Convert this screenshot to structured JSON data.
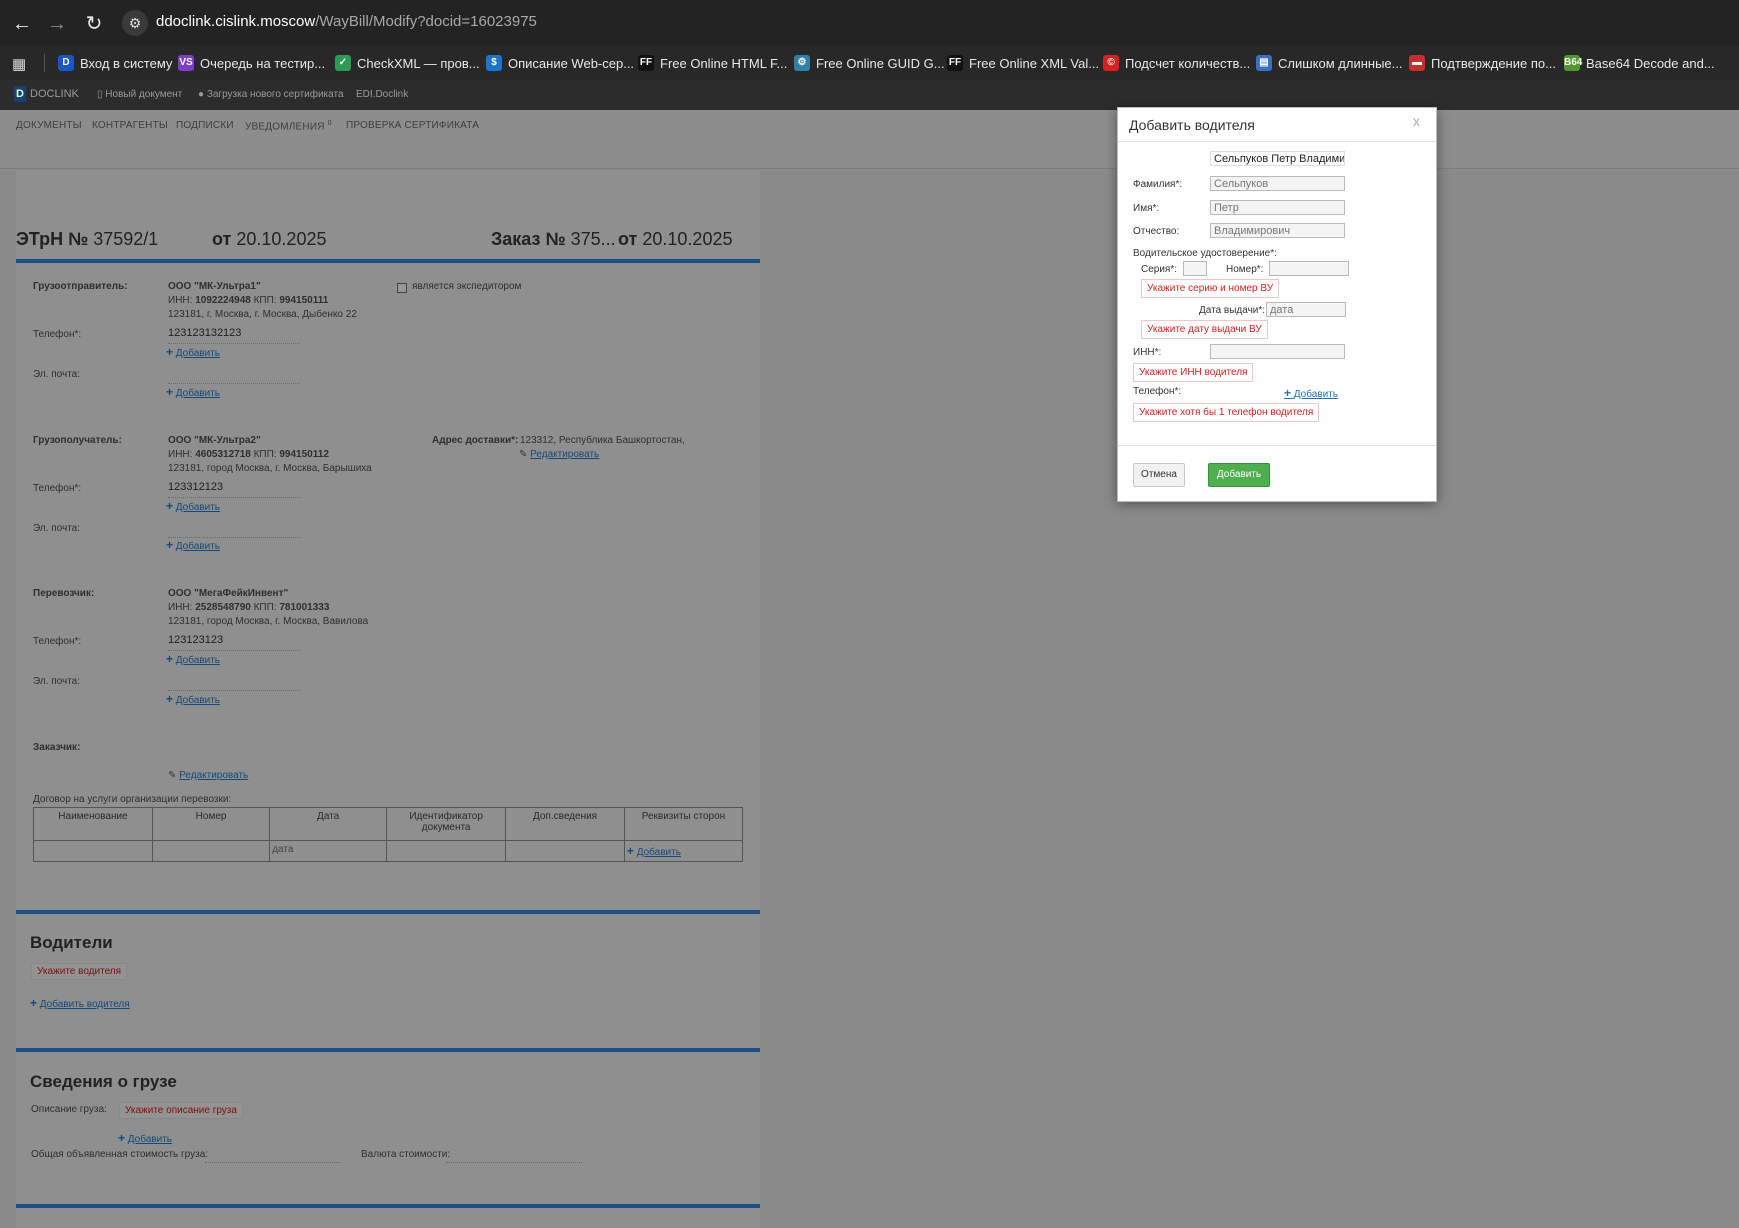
{
  "browser": {
    "url_host": "ddoclink.cislink.moscow",
    "url_path": "/WayBill/Modify?docid=16023975",
    "bookmarks": [
      {
        "label": "Вход в систему",
        "icon": "D",
        "color": "#1a56c4"
      },
      {
        "label": "Очередь на тестир...",
        "icon": "VS",
        "color": "#7b3fc9"
      },
      {
        "label": "CheckXML — пров...",
        "icon": "✓",
        "color": "#2e9a55"
      },
      {
        "label": "Описание Web-сер...",
        "icon": "$",
        "color": "#1d74c8"
      },
      {
        "label": "Free Online HTML F...",
        "icon": "FF",
        "color": "#111111"
      },
      {
        "label": "Free Online GUID G...",
        "icon": "⚙",
        "color": "#2f7fa8"
      },
      {
        "label": "Free Online XML Val...",
        "icon": "FF",
        "color": "#111111"
      },
      {
        "label": "Подсчет количеств...",
        "icon": "©",
        "color": "#d42222"
      },
      {
        "label": "Слишком длинные...",
        "icon": "▤",
        "color": "#3a6fc3"
      },
      {
        "label": "Подтверждение по...",
        "icon": "▬",
        "color": "#c23030"
      },
      {
        "label": "Base64 Decode and...",
        "icon": "B64",
        "color": "#4f9a2c"
      }
    ]
  },
  "app_bar": {
    "brand": "DOCLINK",
    "items": [
      "Новый документ",
      "Загрузка нового сертификата",
      "EDI.Doclink"
    ]
  },
  "menu": {
    "items": [
      "ДОКУМЕНТЫ",
      "КОНТРАГЕНТЫ",
      "ПОДПИСКИ",
      "УВЕДОМЛЕНИЯ",
      "ПРОВЕРКА СЕРТИФИКАТА"
    ],
    "notifications_count": "0"
  },
  "doc": {
    "title_prefix": "ЭТрН №",
    "number": "37592/1",
    "from_word": "от",
    "date": "20.10.2025",
    "order_prefix": "Заказ №",
    "order_number": "375...",
    "order_date": "20.10.2025",
    "shipper": {
      "label": "Грузоотправитель:",
      "name": "ООО \"МК-Ультра1\"",
      "inn_label": "ИНН:",
      "inn": "1092224948",
      "kpp_label": "КПП:",
      "kpp": "994150111",
      "address": "123181, г. Москва, г. Москва, Дыбенко 22",
      "phone_label": "Телефон*:",
      "phone": "123123132123",
      "email_label": "Эл. почта:",
      "forwarder_label": "является экспедитором"
    },
    "consignee": {
      "label": "Грузополучатель:",
      "name": "ООО \"МК-Ультра2\"",
      "inn_label": "ИНН:",
      "inn": "4605312718",
      "kpp_label": "КПП:",
      "kpp": "994150112",
      "address": "123181, город Москва, г. Москва, Барышиха",
      "phone_label": "Телефон*:",
      "phone": "123312123",
      "email_label": "Эл. почта:",
      "delivery_label": "Адрес доставки*:",
      "delivery_value": "123312, Республика Башкортостан,",
      "edit": "Редактировать"
    },
    "carrier": {
      "label": "Перевозчик:",
      "name": "ООО \"МегаФейкИнвент\"",
      "inn_label": "ИНН:",
      "inn": "2528548790",
      "kpp_label": "КПП:",
      "kpp": "781001333",
      "address": "123181, город Москва, г. Москва, Вавилова",
      "phone_label": "Телефон*:",
      "phone": "123123123",
      "email_label": "Эл. почта:"
    },
    "customer": {
      "label": "Заказчик:",
      "edit": "Редактировать"
    },
    "add": "Добавить",
    "contract": {
      "caption": "Договор на услуги организации перевозки:",
      "headers": [
        "Наименование",
        "Номер",
        "Дата",
        "Идентификатор документа",
        "Доп.сведения",
        "Реквизиты сторон"
      ],
      "date_placeholder": "дата"
    },
    "drivers": {
      "heading": "Водители",
      "error": "Укажите водителя",
      "add": "Добавить водителя"
    },
    "cargo": {
      "heading": "Сведения о грузе",
      "desc_label": "Описание груза:",
      "desc_error": "Укажите описание груза",
      "cost_label": "Общая объявленная стоимость груза:",
      "currency_label": "Валюта стоимости:"
    }
  },
  "modal": {
    "title": "Добавить водителя",
    "close": "x",
    "full_name": "Сельпуков Петр Владимир",
    "surname_label": "Фамилия*:",
    "surname": "Сельпуков",
    "name_label": "Имя*:",
    "name": "Петр",
    "patronymic_label": "Отчество:",
    "patronymic": "Владимирович",
    "license_label": "Водительское удостоверение*:",
    "series_label": "Серия*:",
    "number_label": "Номер*:",
    "series_number_error": "Укажите серию и номер ВУ",
    "issue_date_label": "Дата выдачи*:",
    "issue_date_placeholder": "дата",
    "issue_date_error": "Укажите дату выдачи ВУ",
    "inn_label": "ИНН*:",
    "inn_error": "Укажите ИНН водителя",
    "phone_label": "Телефон*:",
    "phone_add": "Добавить",
    "phone_error": "Укажите хотя бы 1 телефон водителя",
    "cancel": "Отмена",
    "submit": "Добавить"
  }
}
